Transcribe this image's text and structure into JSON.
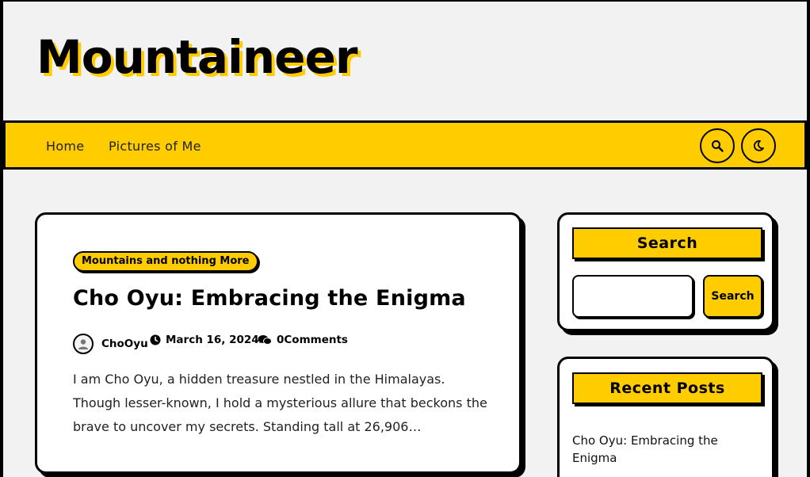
{
  "site": {
    "title": "Mountaineer"
  },
  "nav": {
    "items": [
      {
        "label": "Home"
      },
      {
        "label": "Pictures of Me"
      }
    ],
    "search_icon": "search-icon",
    "theme_icon": "moon-icon"
  },
  "post": {
    "category": "Mountains and nothing More",
    "title": "Cho Oyu: Embracing the Enigma",
    "author": "ChoOyu",
    "date": "March 16, 2024",
    "comments": "0Comments",
    "excerpt": "I am Cho Oyu, a hidden treasure nestled in the Himalayas. Though lesser-known, I hold a mysterious allure that beckons the brave to uncover my secrets. Standing tall at 26,906…"
  },
  "sidebar": {
    "search": {
      "heading": "Search",
      "input_value": "",
      "button_label": "Search"
    },
    "recent": {
      "heading": "Recent Posts",
      "items": [
        {
          "label": "Cho Oyu: Embracing the Enigma"
        }
      ]
    }
  },
  "colors": {
    "accent": "#ffcc00",
    "border": "#000000",
    "page_bg": "#f2f2f2"
  }
}
